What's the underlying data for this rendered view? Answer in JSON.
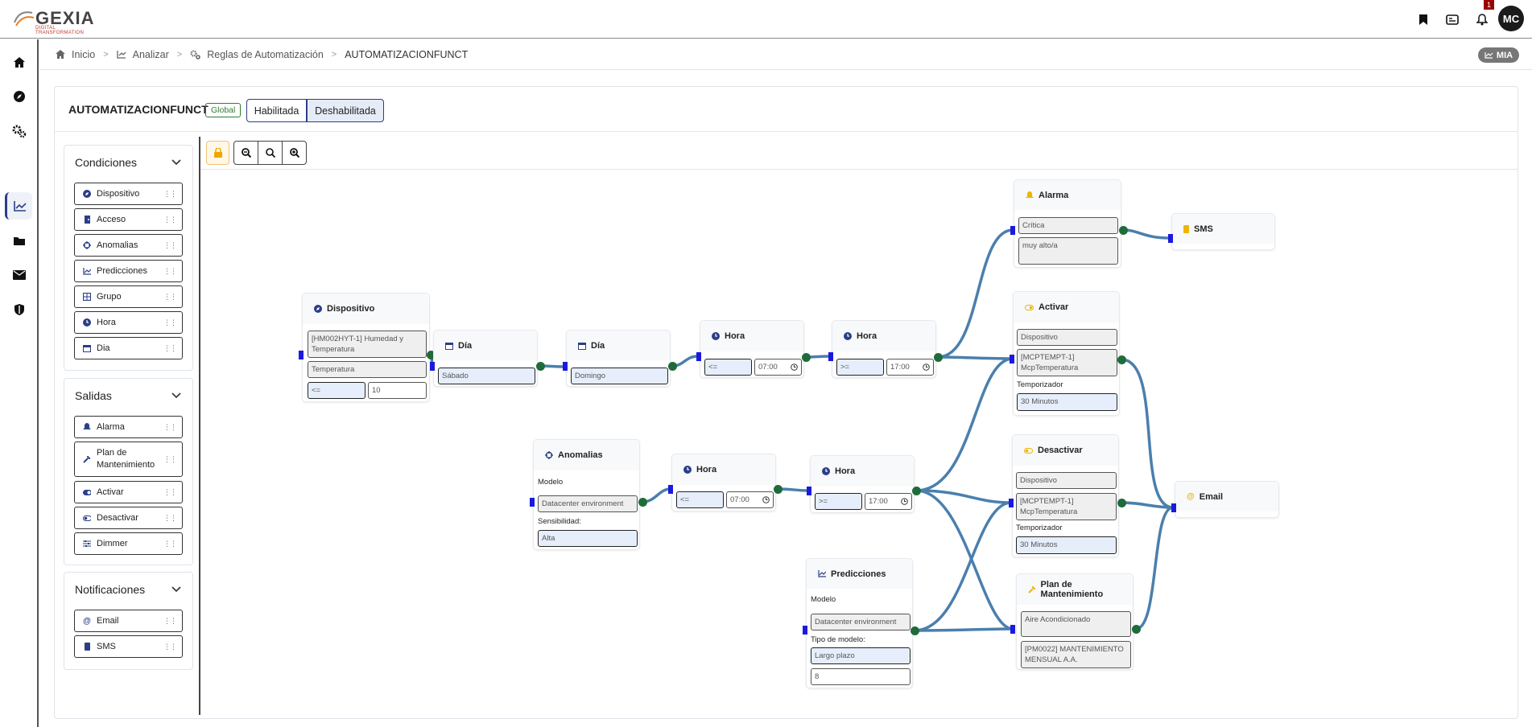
{
  "app": {
    "brand": "GEXIA",
    "brand_tagline": "DIGITAL TRANSFORMATION",
    "user_initials": "MC",
    "notification_count": "1"
  },
  "topbar_icons": [
    "bookmark-icon",
    "id-card-icon",
    "bell-icon"
  ],
  "sidebar": {
    "items": [
      "home-icon",
      "compass-icon",
      "gears-icon",
      "chart-line-icon",
      "folder-icon",
      "envelope-icon",
      "shield-icon"
    ],
    "active": "chart-line-icon"
  },
  "breadcrumb": {
    "items": [
      "Inicio",
      "Analizar",
      "Reglas de Automatización",
      "AUTOMATIZACIONFUNCT"
    ]
  },
  "mia_label": "MIA",
  "rule": {
    "title": "AUTOMATIZACIONFUNCT",
    "scope_badge": "Global",
    "toggle": {
      "enabled_label": "Habilitada",
      "disabled_label": "Deshabilitada",
      "selected": "Deshabilitada"
    }
  },
  "palette": {
    "conditions": {
      "title": "Condiciones",
      "items": [
        "Dispositivo",
        "Acceso",
        "Anomalias",
        "Predicciones",
        "Grupo",
        "Hora",
        "Dia"
      ]
    },
    "outputs": {
      "title": "Salidas",
      "items": [
        "Alarma",
        "Plan de Mantenimiento",
        "Activar",
        "Desactivar",
        "Dimmer"
      ]
    },
    "notifications": {
      "title": "Notificaciones",
      "items": [
        "Email",
        "SMS"
      ]
    }
  },
  "toolbar": [
    "lock-icon",
    "zoom-out-icon",
    "zoom-reset-icon",
    "zoom-in-icon"
  ],
  "nodes": {
    "dispositivo": {
      "title": "Dispositivo",
      "device": "[HM002HYT-1] Humedad y Temperatura",
      "variable": "Temperatura",
      "operator": "<=",
      "value": "10"
    },
    "dia1": {
      "title": "Día",
      "value": "Sábado"
    },
    "dia2": {
      "title": "Día",
      "value": "Domingo"
    },
    "hora1": {
      "title": "Hora",
      "operator": "<=",
      "time": "07:00"
    },
    "hora2": {
      "title": "Hora",
      "operator": ">=",
      "time": "17:00"
    },
    "anomalias": {
      "title": "Anomalias",
      "model_label": "Modelo",
      "model": "Datacenter environment",
      "sens_label": "Sensibilidad:",
      "sens": "Alta"
    },
    "hora3": {
      "title": "Hora",
      "operator": "<=",
      "time": "07:00"
    },
    "hora4": {
      "title": "Hora",
      "operator": ">=",
      "time": "17:00"
    },
    "predicciones": {
      "title": "Predicciones",
      "model_label": "Modelo",
      "model": "Datacenter environment",
      "type_label": "Tipo de modelo:",
      "type": "Largo plazo",
      "value": "8"
    },
    "alarma": {
      "title": "Alarma",
      "severity": "Crítica",
      "message": "muy alto/a"
    },
    "sms": {
      "title": "SMS"
    },
    "activar": {
      "title": "Activar",
      "target": "Dispositivo",
      "device": "[MCPTEMPT-1] McpTemperatura",
      "timer_label": "Temporizador",
      "timer": "30 Minutos"
    },
    "desactivar": {
      "title": "Desactivar",
      "target": "Dispositivo",
      "device": "[MCPTEMPT-1] McpTemperatura",
      "timer_label": "Temporizador",
      "timer": "30 Minutos"
    },
    "plan": {
      "title": "Plan de Mantenimiento",
      "asset": "Aire Acondicionado",
      "plan": "[PM0022] MANTENIMIENTO MENSUAL A.A."
    },
    "email": {
      "title": "Email"
    }
  },
  "colors": {
    "wire": "#4a7fad",
    "port_in": "#1a1adf",
    "port_out": "#1f6b3a",
    "accent": "#2c3e87"
  }
}
